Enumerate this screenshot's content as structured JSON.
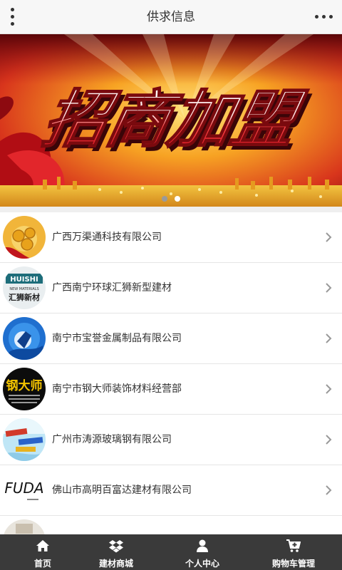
{
  "header": {
    "title": "供求信息",
    "menu_icon": "vertical-dots-icon",
    "more_icon": "horizontal-dots-icon"
  },
  "banner": {
    "headline": "招商加盟",
    "slide_count": 2,
    "active_slide": 2,
    "dot_active_color": "#ffffff",
    "dot_inactive_color": "#9a9a9a"
  },
  "companies": [
    {
      "name": "广西万渠通科技有限公司",
      "thumb": "gold-coins-thumbnail"
    },
    {
      "name": "广西南宁环球汇狮新型建材",
      "thumb": "huishi-logo-thumbnail",
      "thumb_text": [
        "HUISHI",
        "NEW MATERIALS",
        "汇狮新材"
      ]
    },
    {
      "name": "南宁市宝誉金属制品有限公司",
      "thumb": "blue-globe-thumbnail"
    },
    {
      "name": "南宁市钢大师装饰材料经营部",
      "thumb": "steel-master-logo-thumbnail",
      "thumb_text": [
        "钢大师"
      ]
    },
    {
      "name": "广州市涛源玻璃钢有限公司",
      "thumb": "sky-banner-thumbnail"
    },
    {
      "name": "佛山市高明百富达建材有限公司",
      "thumb": "fuda-logo-thumbnail",
      "thumb_text": [
        "FUDA"
      ]
    }
  ],
  "tabs": [
    {
      "label": "首页",
      "icon": "home-icon"
    },
    {
      "label": "建材商城",
      "icon": "dropbox-icon"
    },
    {
      "label": "个人中心",
      "icon": "user-icon"
    },
    {
      "label": "购物车管理",
      "icon": "cart-add-icon"
    }
  ],
  "colors": {
    "header_bg": "#f7f7f7",
    "tabbar_bg": "#3a3a3a",
    "text": "#333333",
    "chevron": "#999999",
    "banner_red": "#c8141e",
    "banner_gold": "#f6b81a"
  }
}
